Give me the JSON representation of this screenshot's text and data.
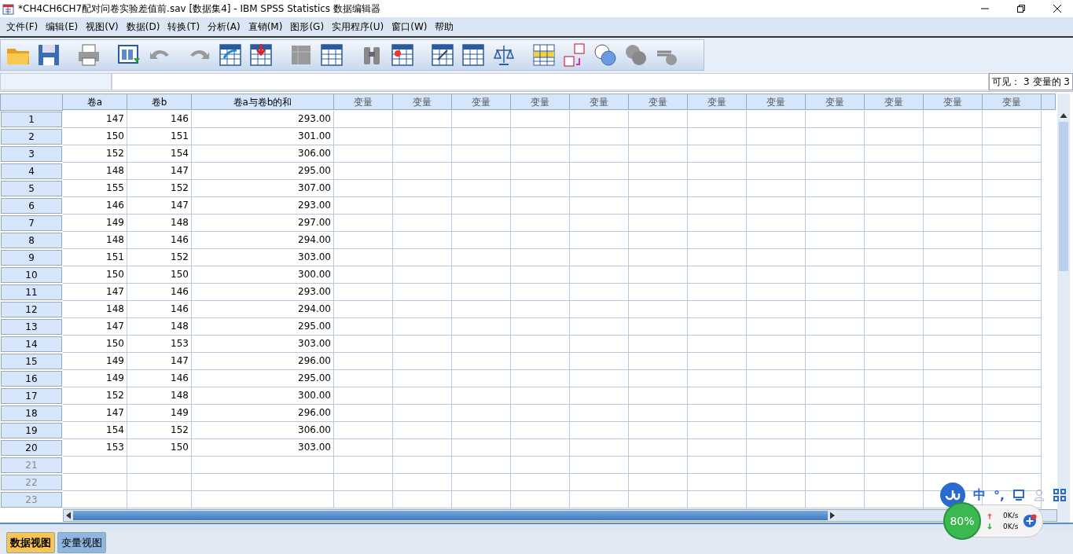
{
  "window": {
    "title": "*CH4CH6CH7配对问卷实验差值前.sav [数据集4] - IBM SPSS Statistics 数据编辑器"
  },
  "menu": [
    "文件(F)",
    "编辑(E)",
    "视图(V)",
    "数据(D)",
    "转换(T)",
    "分析(A)",
    "直销(M)",
    "图形(G)",
    "实用程序(U)",
    "窗口(W)",
    "帮助"
  ],
  "cell_editor": {
    "visible_count": "可见： 3 变量的 3"
  },
  "table": {
    "columns": [
      "卷a",
      "卷b",
      "卷a与卷b的和",
      "变量",
      "变量",
      "变量",
      "变量",
      "变量",
      "变量",
      "变量",
      "变量",
      "变量",
      "变量",
      "变量",
      "变量"
    ],
    "rows": [
      {
        "number": "1",
        "used": true,
        "cells": [
          "147",
          "146",
          "293.00"
        ]
      },
      {
        "number": "2",
        "used": true,
        "cells": [
          "150",
          "151",
          "301.00"
        ]
      },
      {
        "number": "3",
        "used": true,
        "cells": [
          "152",
          "154",
          "306.00"
        ]
      },
      {
        "number": "4",
        "used": true,
        "cells": [
          "148",
          "147",
          "295.00"
        ]
      },
      {
        "number": "5",
        "used": true,
        "cells": [
          "155",
          "152",
          "307.00"
        ]
      },
      {
        "number": "6",
        "used": true,
        "cells": [
          "146",
          "147",
          "293.00"
        ]
      },
      {
        "number": "7",
        "used": true,
        "cells": [
          "149",
          "148",
          "297.00"
        ]
      },
      {
        "number": "8",
        "used": true,
        "cells": [
          "148",
          "146",
          "294.00"
        ]
      },
      {
        "number": "9",
        "used": true,
        "cells": [
          "151",
          "152",
          "303.00"
        ]
      },
      {
        "number": "10",
        "used": true,
        "cells": [
          "150",
          "150",
          "300.00"
        ]
      },
      {
        "number": "11",
        "used": true,
        "cells": [
          "147",
          "146",
          "293.00"
        ]
      },
      {
        "number": "12",
        "used": true,
        "cells": [
          "148",
          "146",
          "294.00"
        ]
      },
      {
        "number": "13",
        "used": true,
        "cells": [
          "147",
          "148",
          "295.00"
        ]
      },
      {
        "number": "14",
        "used": true,
        "cells": [
          "150",
          "153",
          "303.00"
        ]
      },
      {
        "number": "15",
        "used": true,
        "cells": [
          "149",
          "147",
          "296.00"
        ]
      },
      {
        "number": "16",
        "used": true,
        "cells": [
          "149",
          "146",
          "295.00"
        ]
      },
      {
        "number": "17",
        "used": true,
        "cells": [
          "152",
          "148",
          "300.00"
        ]
      },
      {
        "number": "18",
        "used": true,
        "cells": [
          "147",
          "149",
          "296.00"
        ]
      },
      {
        "number": "19",
        "used": true,
        "cells": [
          "154",
          "152",
          "306.00"
        ]
      },
      {
        "number": "20",
        "used": true,
        "cells": [
          "153",
          "150",
          "303.00"
        ]
      },
      {
        "number": "21",
        "used": false,
        "cells": []
      },
      {
        "number": "22",
        "used": false,
        "cells": []
      },
      {
        "number": "23",
        "used": false,
        "cells": []
      }
    ]
  },
  "view_tabs": [
    {
      "label": "数据视图",
      "selected": true
    },
    {
      "label": "变量视图",
      "selected": false
    }
  ],
  "ime_bar": {
    "mode": "中",
    "punct": "°,"
  },
  "speed_widget": {
    "percent": "80%",
    "upload": "0K/s",
    "download": "0K/s"
  }
}
